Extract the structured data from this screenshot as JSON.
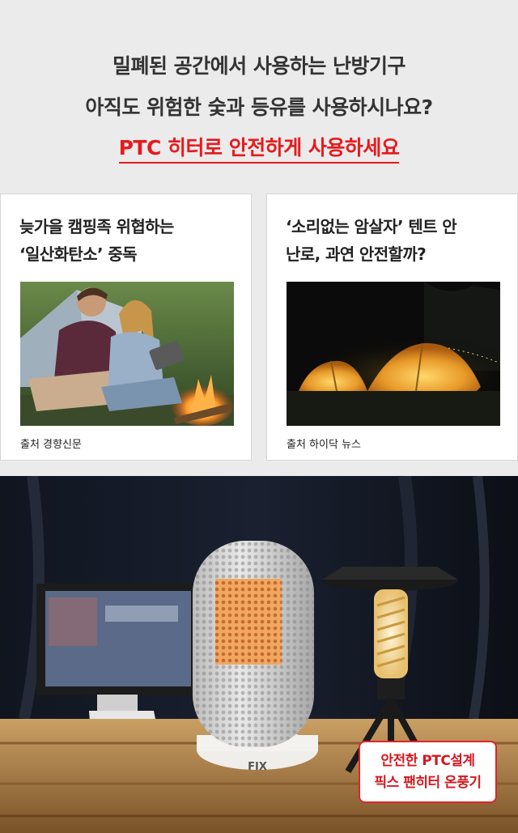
{
  "headline": {
    "line1": "밀폐된 공간에서 사용하는 난방기구",
    "line2": "아직도 위험한 숯과 등유를 사용하시나요?",
    "line3": "PTC 히터로 안전하게 사용하세요"
  },
  "cards": [
    {
      "title_line1": "늦가을 캠핑족 위협하는",
      "title_line2": "‘일산화탄소’ 중독",
      "source": "출처 경향신문",
      "photo_icon": "couple-campfire-photo"
    },
    {
      "title_line1": "‘소리없는 암살자’ 텐트 안",
      "title_line2": "난로, 과연 안전할까?",
      "source": "출처 하이닥 뉴스",
      "photo_icon": "night-tents-photo"
    }
  ],
  "product": {
    "caption_line1": "안전한 PTC설계",
    "caption_line2": "픽스 팬히터 온풍기",
    "logo_text": "FIX",
    "accent_color": "#e0242a"
  }
}
